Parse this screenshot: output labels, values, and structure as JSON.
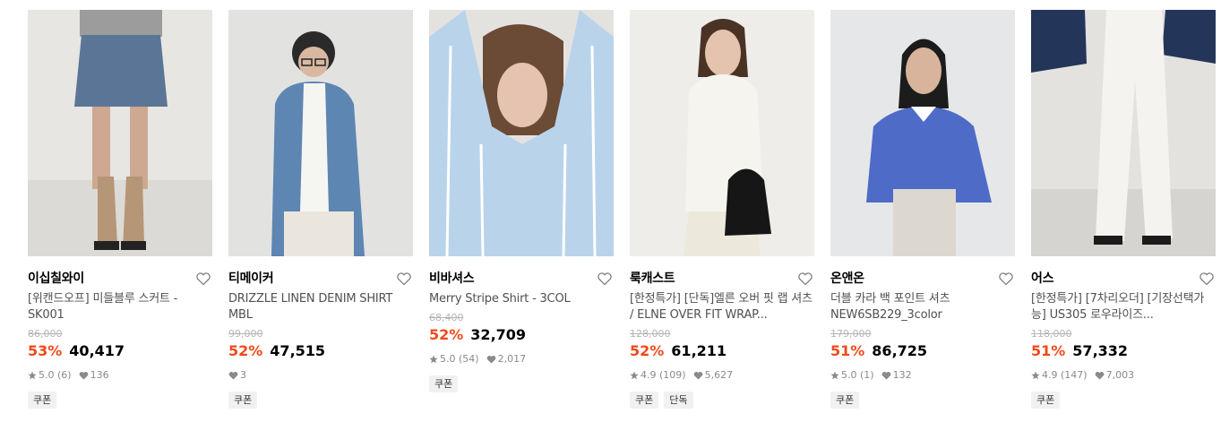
{
  "products": [
    {
      "brand": "이십칠와이",
      "name": "[위캔드오프] 미들블루 스커트 - SK001",
      "original_price": "86,000",
      "discount": "53%",
      "price": "40,417",
      "rating": "5.0 (6)",
      "likes": "136",
      "tags": [
        "쿠폰"
      ]
    },
    {
      "brand": "티메이커",
      "name": "DRIZZLE LINEN DENIM SHIRT MBL",
      "original_price": "99,000",
      "discount": "52%",
      "price": "47,515",
      "rating": "",
      "likes": "3",
      "tags": [
        "쿠폰"
      ]
    },
    {
      "brand": "비바셔스",
      "name": "Merry Stripe Shirt - 3COL",
      "original_price": "68,400",
      "discount": "52%",
      "price": "32,709",
      "rating": "5.0 (54)",
      "likes": "2,017",
      "tags": [
        "쿠폰"
      ]
    },
    {
      "brand": "룩캐스트",
      "name": "[한정특가] [단독]엘른 오버 핏 랩 셔츠 / ELNE OVER FIT WRAP...",
      "original_price": "128,000",
      "discount": "52%",
      "price": "61,211",
      "rating": "4.9 (109)",
      "likes": "5,627",
      "tags": [
        "쿠폰",
        "단독"
      ]
    },
    {
      "brand": "온앤온",
      "name": "더블 카라 백 포인트 셔츠 NEW6SB229_3color",
      "original_price": "179,000",
      "discount": "51%",
      "price": "86,725",
      "rating": "5.0 (1)",
      "likes": "132",
      "tags": [
        "쿠폰"
      ]
    },
    {
      "brand": "어스",
      "name": "[한정특가] [7차리오더] [기장선택가능] US305 로우라이즈...",
      "original_price": "118,000",
      "discount": "51%",
      "price": "57,332",
      "rating": "4.9 (147)",
      "likes": "7,003",
      "tags": [
        "쿠폰"
      ]
    }
  ],
  "colors": {
    "discount": "#f1491b",
    "muted": "#8a8a8a",
    "tag_bg": "#f1f1f1"
  },
  "icons": {
    "wishlist": "heart-outline-icon",
    "star": "star-icon",
    "like": "heart-filled-icon"
  }
}
